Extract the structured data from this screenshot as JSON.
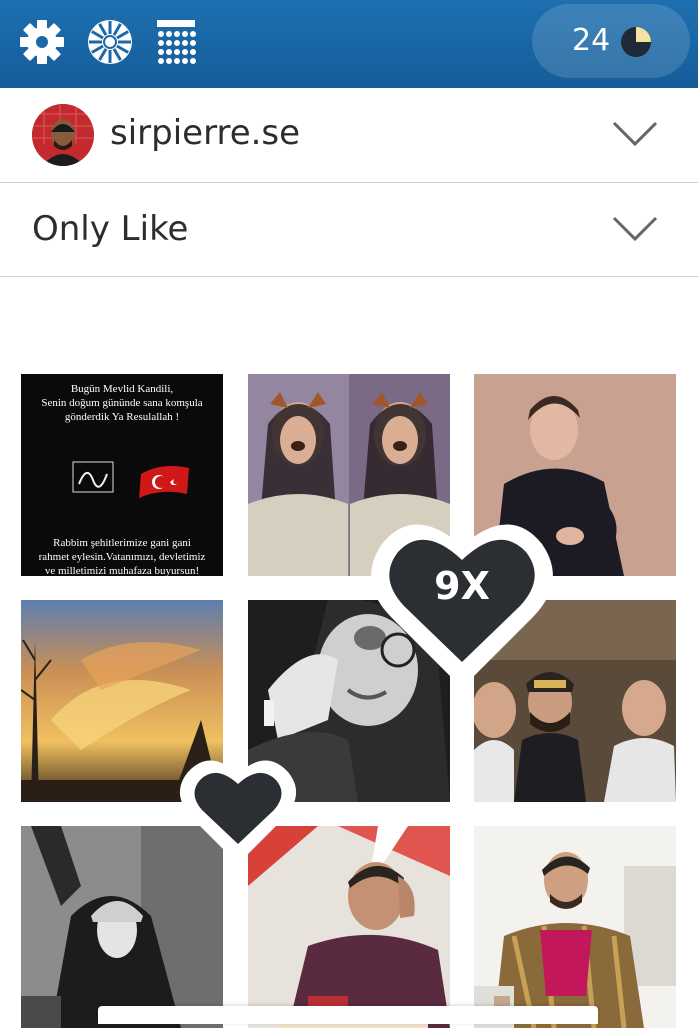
{
  "toolbar": {
    "settings_icon": "gear-icon",
    "dial_icon": "dial-icon",
    "grid_icon": "calendar-grid-icon",
    "counter_value": "24",
    "counter_icon": "pie-timer-icon",
    "counter_fraction": 0.25,
    "bg_color": "#1a68a8"
  },
  "account": {
    "username": "sirpierre.se",
    "avatar_icon": "avatar",
    "dropdown_icon": "chevron-down-icon"
  },
  "mode": {
    "selected": "Only Like",
    "dropdown_icon": "chevron-down-icon"
  },
  "photo1": {
    "line1": "Bugün Mevlid Kandili,",
    "line2": "Senin doğum gününde sana komşula",
    "line3": "gönderdik Ya Resulallah !",
    "line4": "Rabbim şehitlerimize gani gani",
    "line5": "rahmet eylesin.Vatanımızı, devletimiz",
    "line6": "ve milletimizi muhafaza buyursun!"
  },
  "overlay": {
    "big_heart_label": "9X",
    "big_heart_icon": "heart-icon",
    "small_heart_icon": "heart-icon",
    "heart_color": "#2b2f33"
  }
}
